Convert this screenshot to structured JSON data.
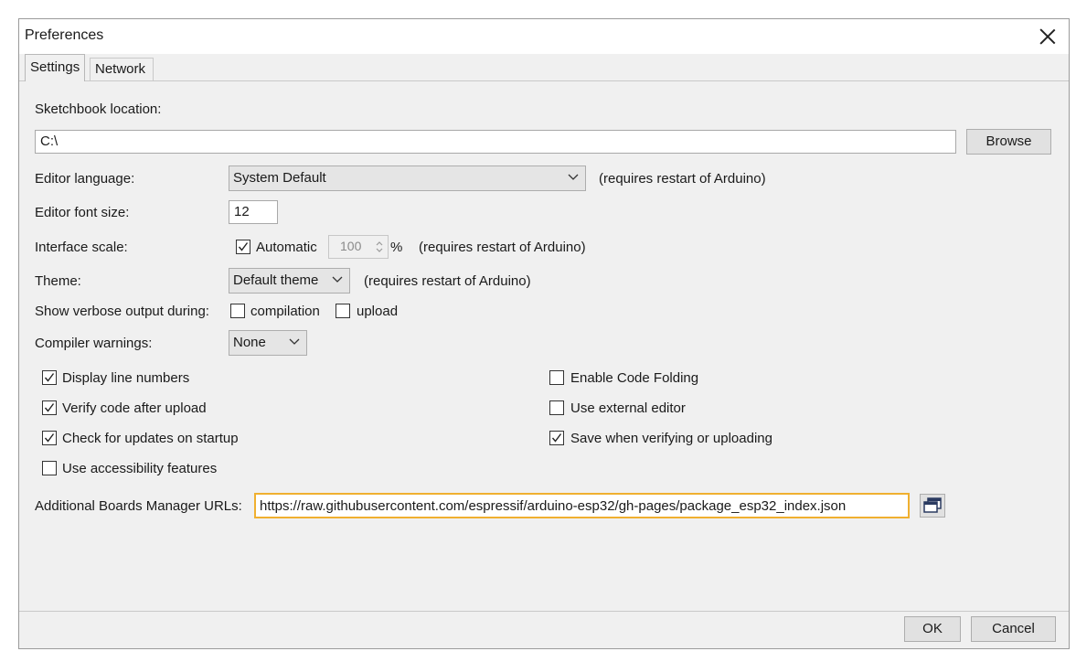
{
  "window": {
    "title": "Preferences"
  },
  "tabs": [
    {
      "label": "Settings"
    },
    {
      "label": "Network"
    }
  ],
  "settings": {
    "sketchbook": {
      "label": "Sketchbook location:",
      "value": "C:\\",
      "browse": "Browse"
    },
    "language": {
      "label": "Editor language:",
      "value": "System Default",
      "note": "(requires restart of Arduino)"
    },
    "font_size": {
      "label": "Editor font size:",
      "value": "12"
    },
    "scale": {
      "label": "Interface scale:",
      "automatic_label": "Automatic",
      "automatic_checked": true,
      "value": "100",
      "unit": "%",
      "note": "(requires restart of Arduino)"
    },
    "theme": {
      "label": "Theme:",
      "value": "Default theme",
      "note": "(requires restart of Arduino)"
    },
    "verbose": {
      "label": "Show verbose output during:",
      "compilation": "compilation",
      "compilation_checked": false,
      "upload": "upload",
      "upload_checked": false
    },
    "warnings": {
      "label": "Compiler warnings:",
      "value": "None"
    },
    "checkboxes": [
      {
        "label": "Display line numbers",
        "checked": true
      },
      {
        "label": "Verify code after upload",
        "checked": true
      },
      {
        "label": "Check for updates on startup",
        "checked": true
      },
      {
        "label": "Use accessibility features",
        "checked": false
      },
      {
        "label": "Enable Code Folding",
        "checked": false
      },
      {
        "label": "Use external editor",
        "checked": false
      },
      {
        "label": "Save when verifying or uploading",
        "checked": true
      }
    ],
    "boards_urls": {
      "label": "Additional Boards Manager URLs:",
      "value": "https://raw.githubusercontent.com/espressif/arduino-esp32/gh-pages/package_esp32_index.json",
      "highlight_color": "#f0b030"
    }
  },
  "footer": {
    "ok": "OK",
    "cancel": "Cancel"
  }
}
